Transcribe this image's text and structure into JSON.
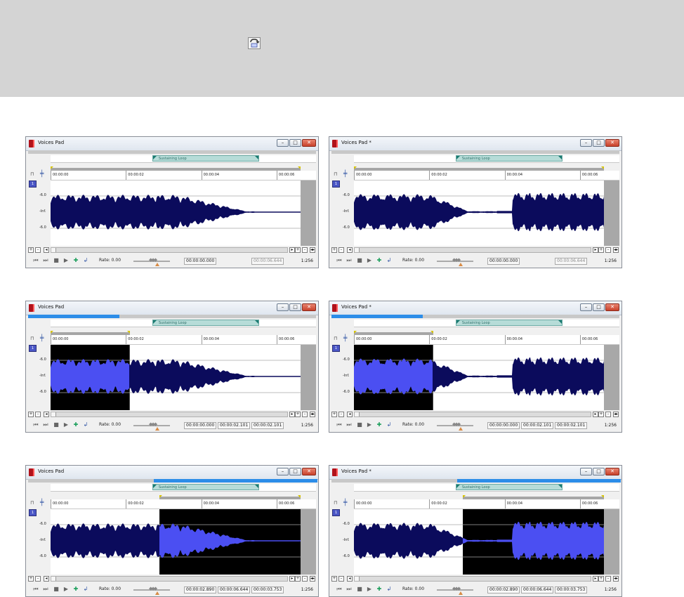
{
  "colors": {
    "waveform": "#0b0b5c",
    "waveform_selected": "#4b4ff2",
    "selection_bg": "#000000",
    "overview_highlight": "#2c8de8",
    "loop_region": "#b6dcd8",
    "marker": "#d6c300"
  },
  "toolbar": {
    "loop_tool_icon": "loop-region-tool-icon"
  },
  "common": {
    "loop_label": "Sustaining Loop",
    "channel_label": "1",
    "db_labels": [
      "-6.0",
      "-Inf.",
      "-6.0"
    ],
    "ruler_ticks": [
      "00:00:00",
      "00:00:02",
      "00:00:04",
      "00:00:06"
    ],
    "rate_label": "Rate: 0.00",
    "zoom": "1:256"
  },
  "windows": [
    {
      "title": "Voices Pad",
      "selection": false,
      "sel_start": "00:00:00.000",
      "sel_end": "00:00:06.644",
      "sel_len": "",
      "wave": "A",
      "loop_start": 2.7,
      "loop_end": 5.54,
      "sel_from": 0,
      "sel_to": 0,
      "overview_from": 0,
      "overview_to": 0,
      "bar_from": 0.0,
      "bar_to": 6.644
    },
    {
      "title": "Voices Pad *",
      "selection": false,
      "sel_start": "00:00:00.000",
      "sel_end": "00:00:06.644",
      "sel_len": "",
      "wave": "B",
      "loop_start": 2.7,
      "loop_end": 5.54,
      "sel_from": 0,
      "sel_to": 0,
      "overview_from": 0,
      "overview_to": 0,
      "bar_from": 0.0,
      "bar_to": 6.644
    },
    {
      "title": "Voices Pad",
      "selection": true,
      "sel_start": "00:00:00.000",
      "sel_end": "00:00:02.101",
      "sel_len": "00:00:02.101",
      "wave": "A",
      "loop_start": 2.7,
      "loop_end": 5.54,
      "sel_from": 0,
      "sel_to": 2.101,
      "overview_from": 0.0,
      "overview_to": 0.316,
      "bar_from": 0.0,
      "bar_to": 2.101
    },
    {
      "title": "Voices Pad *",
      "selection": true,
      "sel_start": "00:00:00.000",
      "sel_end": "00:00:02.101",
      "sel_len": "00:00:02.101",
      "wave": "B",
      "loop_start": 2.7,
      "loop_end": 5.54,
      "sel_from": 0,
      "sel_to": 2.101,
      "overview_from": 0.0,
      "overview_to": 0.316,
      "bar_from": 0.0,
      "bar_to": 2.101
    },
    {
      "title": "Voices Pad",
      "selection": true,
      "sel_start": "00:00:02.890",
      "sel_end": "00:00:06.644",
      "sel_len": "00:00:03.753",
      "wave": "A",
      "loop_start": 2.7,
      "loop_end": 5.54,
      "sel_from": 2.89,
      "sel_to": 6.644,
      "overview_from": 0.435,
      "overview_to": 1.0,
      "bar_from": 2.89,
      "bar_to": 6.644
    },
    {
      "title": "Voices Pad *",
      "selection": true,
      "sel_start": "00:00:02.890",
      "sel_end": "00:00:06.644",
      "sel_len": "00:00:03.753",
      "wave": "B",
      "loop_start": 2.7,
      "loop_end": 5.54,
      "sel_from": 2.89,
      "sel_to": 6.644,
      "overview_from": 0.435,
      "overview_to": 1.0,
      "bar_from": 2.89,
      "bar_to": 6.644
    }
  ]
}
